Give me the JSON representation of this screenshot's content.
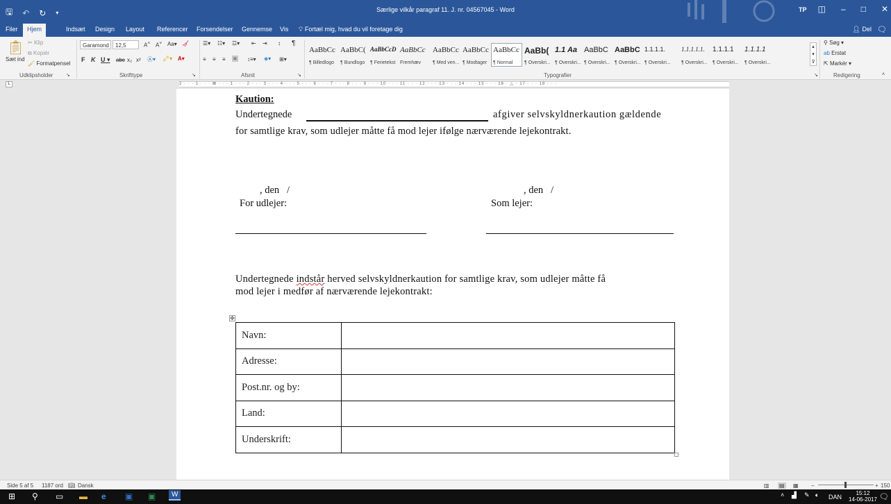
{
  "window": {
    "title": "Særlige vilkår paragraf 11. J. nr. 04567045 - Word",
    "user_initials": "TP",
    "save_icon": "save-icon",
    "minimize": "–",
    "maximize": "□",
    "close": "✕"
  },
  "tabs": [
    {
      "label": "Filer"
    },
    {
      "label": "Hjem"
    },
    {
      "label": "Indsæt"
    },
    {
      "label": "Design"
    },
    {
      "label": "Layout"
    },
    {
      "label": "Referencer"
    },
    {
      "label": "Forsendelser"
    },
    {
      "label": "Gennemse"
    },
    {
      "label": "Vis"
    }
  ],
  "tell_me": "Fortæl mig, hvad du vil foretage dig",
  "share_label": "Del",
  "ribbon": {
    "clipboard": {
      "label": "Udklipsholder",
      "paste": "Sæt ind",
      "cut": "Klip",
      "copy": "Kopiér",
      "format_painter": "Formatpensel"
    },
    "font": {
      "label": "Skrifttype",
      "name": "Garamond",
      "size": "12,5"
    },
    "paragraph": {
      "label": "Afsnit"
    },
    "styles": {
      "label": "Typografier",
      "items": [
        {
          "sample": "AaBbCc",
          "name": "¶ Billedlogo"
        },
        {
          "sample": "AaBbC(",
          "name": "¶ Bundlogo"
        },
        {
          "sample": "AaBbCcD",
          "name": "¶ Ferietekst"
        },
        {
          "sample": "AaBbCc",
          "name": "Fremhæv"
        },
        {
          "sample": "AaBbCc",
          "name": "¶ Med ven..."
        },
        {
          "sample": "AaBbCc",
          "name": "¶ Modtager"
        },
        {
          "sample": "AaBbCc",
          "name": "¶ Normal"
        },
        {
          "sample": "AaBb(",
          "name": "¶ Overskri..."
        },
        {
          "sample": "1.1 Aa",
          "name": "¶ Overskri..."
        },
        {
          "sample": "AaBbC",
          "name": "¶ Overskri..."
        },
        {
          "sample": "AaBbC",
          "name": "¶ Overskri..."
        },
        {
          "sample": "1.1.1.1.",
          "name": "¶ Overskri..."
        },
        {
          "sample": "1.1.1.1.1.",
          "name": "¶ Overskri..."
        },
        {
          "sample": "1.1.1.1",
          "name": "¶ Overskri..."
        },
        {
          "sample": "1.1.1.1",
          "name": "¶ Overskri..."
        }
      ]
    },
    "editing": {
      "label": "Redigering",
      "find": "Søg",
      "replace": "Erstat",
      "select": "Markér"
    }
  },
  "document": {
    "heading": "Kaution:",
    "guarantor_prefix": "Undertegnede",
    "guarantor_suffix": "afgiver selvskyldnerkaution gældende",
    "guarantor_line2": "for samtlige krav, som udlejer måtte få mod lejer ifølge nærværende lejekontrakt.",
    "date_left": ", den   /",
    "date_right": ", den   /",
    "sign_left": "For udlejer:",
    "sign_right": "Som lejer:",
    "para2_a": "Undertegnede",
    "para2_b": "indstår",
    "para2_c": "herved selvskyldnerkaution for samtlige krav, som udlejer måtte få",
    "para2_line2": "mod lejer i medfør af nærværende lejekontrakt:",
    "table_rows": [
      {
        "label": "Navn:",
        "value": ""
      },
      {
        "label": "Adresse:",
        "value": ""
      },
      {
        "label": "Post.nr. og by:",
        "value": ""
      },
      {
        "label": "Land:",
        "value": ""
      },
      {
        "label": "Underskrift:",
        "value": ""
      }
    ]
  },
  "status": {
    "page": "Side 5 af 5",
    "words": "1187 ord",
    "language": "Dansk",
    "zoom": "150 %"
  },
  "taskbar": {
    "lang": "DAN",
    "time": "15:12",
    "date": "14-06-2017"
  }
}
